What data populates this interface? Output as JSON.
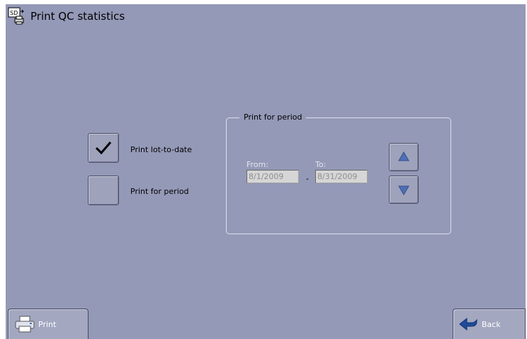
{
  "title": "Print QC statistics",
  "options": [
    {
      "label": "Print lot-to-date",
      "checked": true
    },
    {
      "label": "Print for period",
      "checked": false
    }
  ],
  "period_group": {
    "legend": "Print for period",
    "from_label": "From:",
    "from_value": "8/1/2009",
    "to_label": "To:",
    "to_value": "8/31/2009",
    "separator": "-"
  },
  "buttons": {
    "print_label": "Print",
    "back_label": "Back"
  },
  "icons": {
    "title": "print-statistics-icon",
    "check": "checkmark-icon",
    "up": "arrow-up-icon",
    "down": "arrow-down-icon",
    "print": "printer-icon",
    "back": "back-arrow-icon"
  },
  "colors": {
    "background": "#9499b7",
    "arrow": "#4f6fb4"
  }
}
